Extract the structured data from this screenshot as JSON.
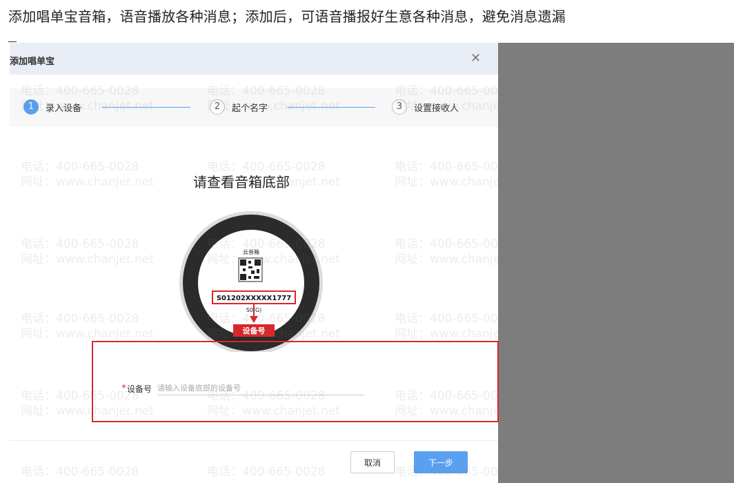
{
  "caption": "添加唱单宝音箱，语音播放各种消息；添加后，可语音播报好生意各种消息，避免消息遗漏",
  "dialog": {
    "title": "添加唱单宝",
    "steps": [
      {
        "num": "1",
        "label": "录入设备"
      },
      {
        "num": "2",
        "label": "起个名字"
      },
      {
        "num": "3",
        "label": "设置接收人"
      }
    ],
    "heading": "请查看音箱底部",
    "illustration": {
      "brand": "云音箱",
      "serial": "S01202XXXXX1777",
      "model": "S0(G)",
      "tag": "设备号"
    },
    "field": {
      "required": "*",
      "label": "设备号",
      "placeholder": "请输入设备底部的设备号"
    },
    "buttons": {
      "cancel": "取消",
      "next": "下一步"
    }
  },
  "watermark": {
    "phone": "电话：400-665-0028",
    "site": "网址：www.chanjet.net"
  },
  "colors": {
    "accent": "#5aa0f0",
    "highlight": "#d9262c",
    "overlay": "#7d7d7d",
    "header": "#e9edf6"
  }
}
